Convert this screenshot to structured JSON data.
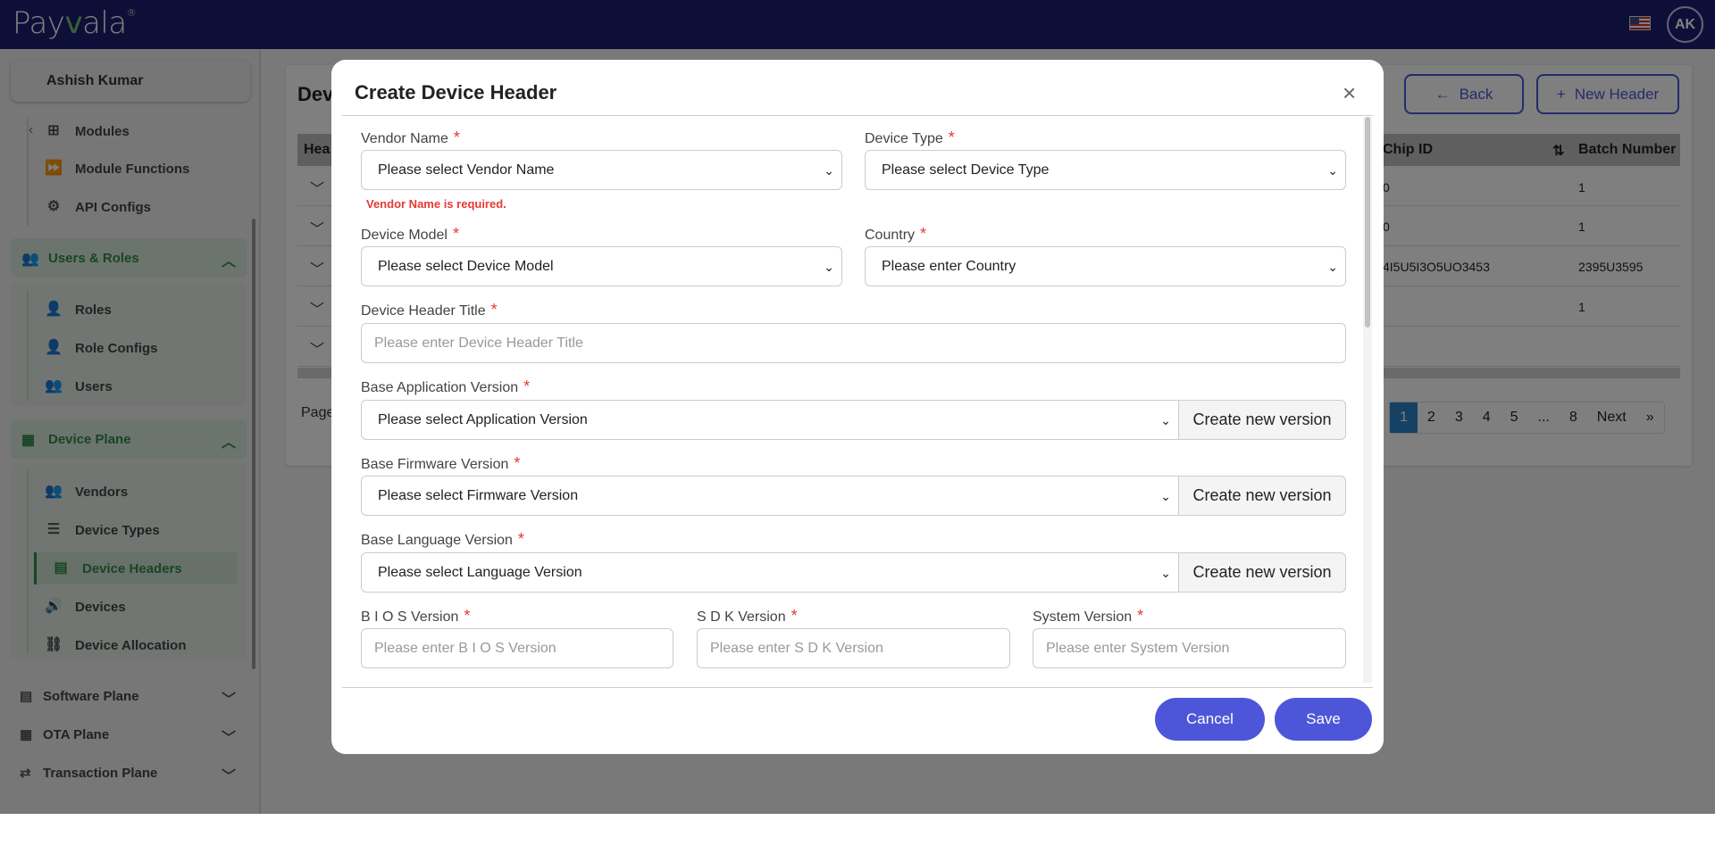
{
  "topbar": {
    "logo_text": "Pay",
    "logo_accent": "v",
    "logo_text_end": "ala",
    "logo_mark": "®",
    "avatar_initials": "AK"
  },
  "sidebar": {
    "user_name": "Ashish Kumar",
    "modules_items": [
      {
        "label": "Modules",
        "icon": "grid-icon"
      },
      {
        "label": "Module Functions",
        "icon": "fast-forward-icon"
      },
      {
        "label": "API Configs",
        "icon": "api-icon"
      }
    ],
    "users_roles": {
      "label": "Users & Roles",
      "items": [
        {
          "label": "Roles"
        },
        {
          "label": "Role Configs"
        },
        {
          "label": "Users"
        }
      ]
    },
    "device_plane": {
      "label": "Device Plane",
      "items": [
        {
          "label": "Vendors"
        },
        {
          "label": "Device Types"
        },
        {
          "label": "Device Headers",
          "active": true
        },
        {
          "label": "Devices"
        },
        {
          "label": "Device Allocation"
        }
      ]
    },
    "collapsed_groups": [
      {
        "label": "Software Plane"
      },
      {
        "label": "OTA Plane"
      },
      {
        "label": "Transaction Plane"
      }
    ]
  },
  "background": {
    "title_partial": "Dev",
    "back_label": "Back",
    "new_header_label": "New Header",
    "table": {
      "first_col_partial": "Hea",
      "chip_id_label": "Chip ID",
      "batch_number_label": "Batch Number",
      "rows": [
        {
          "chip_id": "0",
          "batch": "1"
        },
        {
          "chip_id": "0",
          "batch": "1"
        },
        {
          "chip_id": "4I5U5I3O5UO3453",
          "batch": "2395U3595"
        },
        {
          "chip_id": "",
          "batch": "1"
        },
        {
          "chip_id": "",
          "batch": ""
        }
      ]
    },
    "page_label_partial": "Page",
    "pager": [
      "1",
      "2",
      "3",
      "4",
      "5",
      "...",
      "8",
      "Next",
      "»"
    ]
  },
  "modal": {
    "title": "Create Device Header",
    "close_glyph": "×",
    "fields": {
      "vendor_name": {
        "label": "Vendor Name",
        "value": "Please select Vendor Name",
        "error": "Vendor Name is required."
      },
      "device_type": {
        "label": "Device Type",
        "value": "Please select Device Type"
      },
      "device_model": {
        "label": "Device Model",
        "value": "Please select Device Model"
      },
      "country": {
        "label": "Country",
        "value": "Please enter Country"
      },
      "device_header_title": {
        "label": "Device Header Title",
        "placeholder": "Please enter Device Header Title"
      },
      "base_app_version": {
        "label": "Base Application Version",
        "value": "Please select Application Version"
      },
      "base_firmware_version": {
        "label": "Base Firmware Version",
        "value": "Please select Firmware Version"
      },
      "base_language_version": {
        "label": "Base Language Version",
        "value": "Please select Language Version"
      },
      "bios_version": {
        "label": "B I O S Version",
        "placeholder": "Please enter B I O S Version"
      },
      "sdk_version": {
        "label": "S D K Version",
        "placeholder": "Please enter S D K Version"
      },
      "system_version": {
        "label": "System Version",
        "placeholder": "Please enter System Version"
      }
    },
    "required_mark": "*",
    "create_version_label": "Create new version",
    "cancel_label": "Cancel",
    "save_label": "Save"
  },
  "colors": {
    "topbar": "#1a1f71",
    "accent_green": "#2f8a49",
    "primary": "#4d56d8",
    "error": "#e53935",
    "active_page": "#2a82c8"
  }
}
